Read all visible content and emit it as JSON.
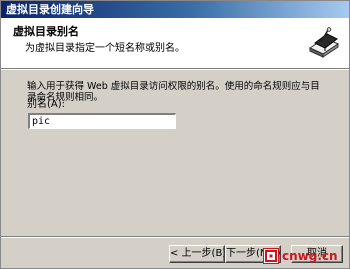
{
  "window": {
    "title": "虚拟目录创建向导"
  },
  "header": {
    "title": "虚拟目录别名",
    "subtitle": "为虚拟目录指定一个短名称或别名。",
    "icon": "wizard-book-icon"
  },
  "body": {
    "description": "输入用于获得 Web 虚拟目录访问权限的别名。使用的命名规则应与目录命名规则相同。",
    "alias_label": "别名(A):",
    "alias_value": "pic"
  },
  "buttons": {
    "back_label": "< 上一步(B)",
    "next_label": "下一步(N) >",
    "cancel_label": "取消"
  },
  "watermark": {
    "text": "cnwg.cn",
    "color": "#d0141e"
  },
  "colors": {
    "titlebar_start": "#0a246a",
    "titlebar_end": "#a6caf0",
    "face": "#d4d0c8"
  }
}
